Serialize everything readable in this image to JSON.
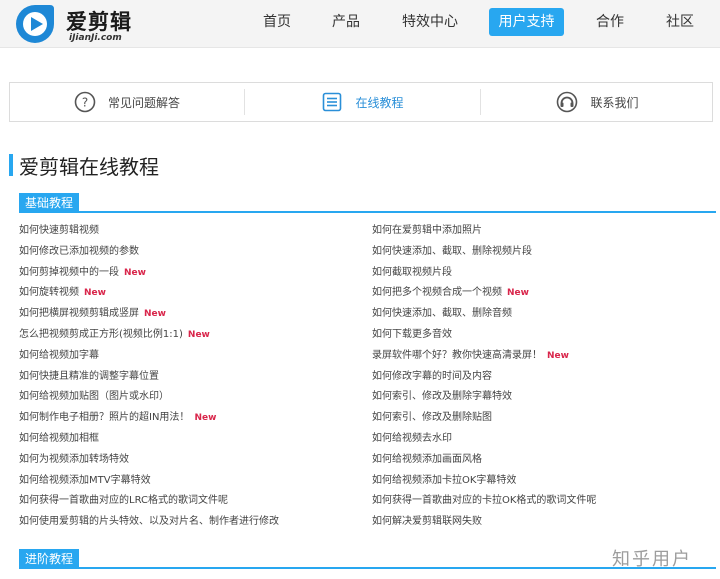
{
  "header": {
    "logo_name": "爱剪辑",
    "logo_sub": "iJianJi.com",
    "nav": [
      {
        "label": "首页"
      },
      {
        "label": "产品"
      },
      {
        "label": "特效中心"
      },
      {
        "label": "用户支持",
        "active": true
      },
      {
        "label": "合作"
      },
      {
        "label": "社区"
      }
    ]
  },
  "subtabs": [
    {
      "label": "常见问题解答",
      "icon": "question-circle-icon"
    },
    {
      "label": "在线教程",
      "icon": "list-doc-icon",
      "active": true
    },
    {
      "label": "联系我们",
      "icon": "headset-icon"
    }
  ],
  "page_title": "爱剪辑在线教程",
  "sections": [
    {
      "title": "基础教程"
    },
    {
      "title": "进阶教程"
    }
  ],
  "new_label": "New",
  "links": {
    "left": [
      {
        "text": "如何快速剪辑视频",
        "new": false
      },
      {
        "text": "如何修改已添加视频的参数",
        "new": false
      },
      {
        "text": "如何剪掉视频中的一段",
        "new": true
      },
      {
        "text": "如何旋转视频",
        "new": true
      },
      {
        "text": "如何把横屏视频剪辑成竖屏",
        "new": true
      },
      {
        "text": "怎么把视频剪成正方形(视频比例1:1)",
        "new": true
      },
      {
        "text": "如何给视频加字幕",
        "new": false
      },
      {
        "text": "如何快捷且精准的调整字幕位置",
        "new": false
      },
      {
        "text": "如何给视频加贴图（图片或水印）",
        "new": false
      },
      {
        "text": "如何制作电子相册？照片的超IN用法！",
        "new": true
      },
      {
        "text": "如何给视频加相框",
        "new": false
      },
      {
        "text": "如何为视频添加转场特效",
        "new": false
      },
      {
        "text": "如何给视频添加MTV字幕特效",
        "new": false
      },
      {
        "text": "如何获得一首歌曲对应的LRC格式的歌词文件呢",
        "new": false
      },
      {
        "text": "如何使用爱剪辑的片头特效、以及对片名、制作者进行修改",
        "new": false
      }
    ],
    "right": [
      {
        "text": "如何在爱剪辑中添加照片",
        "new": false
      },
      {
        "text": "如何快速添加、截取、删除视频片段",
        "new": false
      },
      {
        "text": "如何截取视频片段",
        "new": false
      },
      {
        "text": "如何把多个视频合成一个视频",
        "new": true
      },
      {
        "text": "如何快速添加、截取、删除音频",
        "new": false
      },
      {
        "text": "如何下载更多音效",
        "new": false
      },
      {
        "text": "录屏软件哪个好？教你快速高清录屏！",
        "new": true
      },
      {
        "text": "如何修改字幕的时间及内容",
        "new": false
      },
      {
        "text": "如何索引、修改及删除字幕特效",
        "new": false
      },
      {
        "text": "如何索引、修改及删除贴图",
        "new": false
      },
      {
        "text": "如何给视频去水印",
        "new": false
      },
      {
        "text": "如何给视频添加画面风格",
        "new": false
      },
      {
        "text": "如何给视频添加卡拉OK字幕特效",
        "new": false
      },
      {
        "text": "如何获得一首歌曲对应的卡拉OK格式的歌词文件呢",
        "new": false
      },
      {
        "text": "如何解决爱剪辑联网失败",
        "new": false
      }
    ]
  },
  "watermark": "知乎用户",
  "colors": {
    "accent": "#28a7f0",
    "new_badge": "#d9264b",
    "header_bg": "#f4f4f4"
  }
}
